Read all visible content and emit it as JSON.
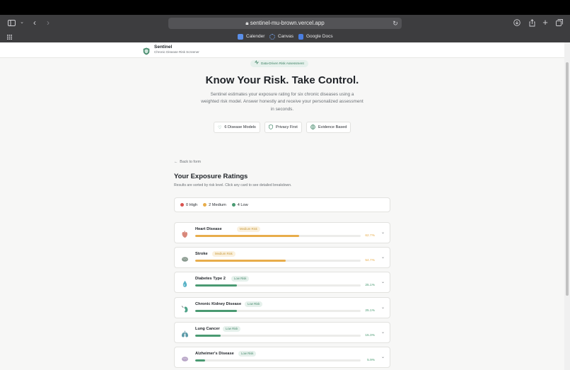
{
  "browser": {
    "url": "sentinel-mu-brown.vercel.app",
    "bookmarks": [
      {
        "label": "Calender",
        "color": "#5b8fe8"
      },
      {
        "label": "Canvas",
        "color": "#3f7fd9"
      },
      {
        "label": "Google Docs",
        "color": "#4a7ee0"
      }
    ]
  },
  "header": {
    "brand": "Sentinel",
    "subtitle": "Chronic Disease Risk Screener"
  },
  "hero": {
    "pill": "Data-Driven Risk Assessment",
    "title": "Know Your Risk. Take Control.",
    "description": "Sentinel estimates your exposure rating for six chronic diseases using a weighted risk model. Answer honestly and receive your personalized assessment in seconds.",
    "chips": [
      "6 Disease Models",
      "Privacy First",
      "Evidence Based"
    ]
  },
  "results": {
    "back": "Back to form",
    "title": "Your Exposure Ratings",
    "subtitle": "Results are sorted by risk level. Click any card to see detailed breakdown.",
    "summary": [
      {
        "label": "0 High",
        "color": "#d9534f"
      },
      {
        "label": "2 Medium",
        "color": "#e8ad4b"
      },
      {
        "label": "4 Low",
        "color": "#4a9a72"
      }
    ],
    "cards": [
      {
        "name": "Heart Disease",
        "badge": "Medium Risk",
        "level": "medium",
        "percent": "62.7%",
        "value": 62.7,
        "icon": "heart-icon"
      },
      {
        "name": "Stroke",
        "badge": "Medium Risk",
        "level": "medium",
        "percent": "54.7%",
        "value": 54.7,
        "icon": "brain-icon"
      },
      {
        "name": "Diabetes Type 2",
        "badge": "Low Risk",
        "level": "low",
        "percent": "25.1%",
        "value": 25.1,
        "icon": "droplet-icon"
      },
      {
        "name": "Chronic Kidney Disease",
        "badge": "Low Risk",
        "level": "low",
        "percent": "25.1%",
        "value": 25.1,
        "icon": "kidney-icon"
      },
      {
        "name": "Lung Cancer",
        "badge": "Low Risk",
        "level": "low",
        "percent": "15.3%",
        "value": 15.3,
        "icon": "lungs-icon"
      },
      {
        "name": "Alzheimer's Disease",
        "badge": "Low Risk",
        "level": "low",
        "percent": "5.9%",
        "value": 5.9,
        "icon": "brain-icon"
      }
    ]
  },
  "colors": {
    "medium": "#e8ad4b",
    "low": "#4a9a72",
    "accent": "#4a8c6f"
  }
}
